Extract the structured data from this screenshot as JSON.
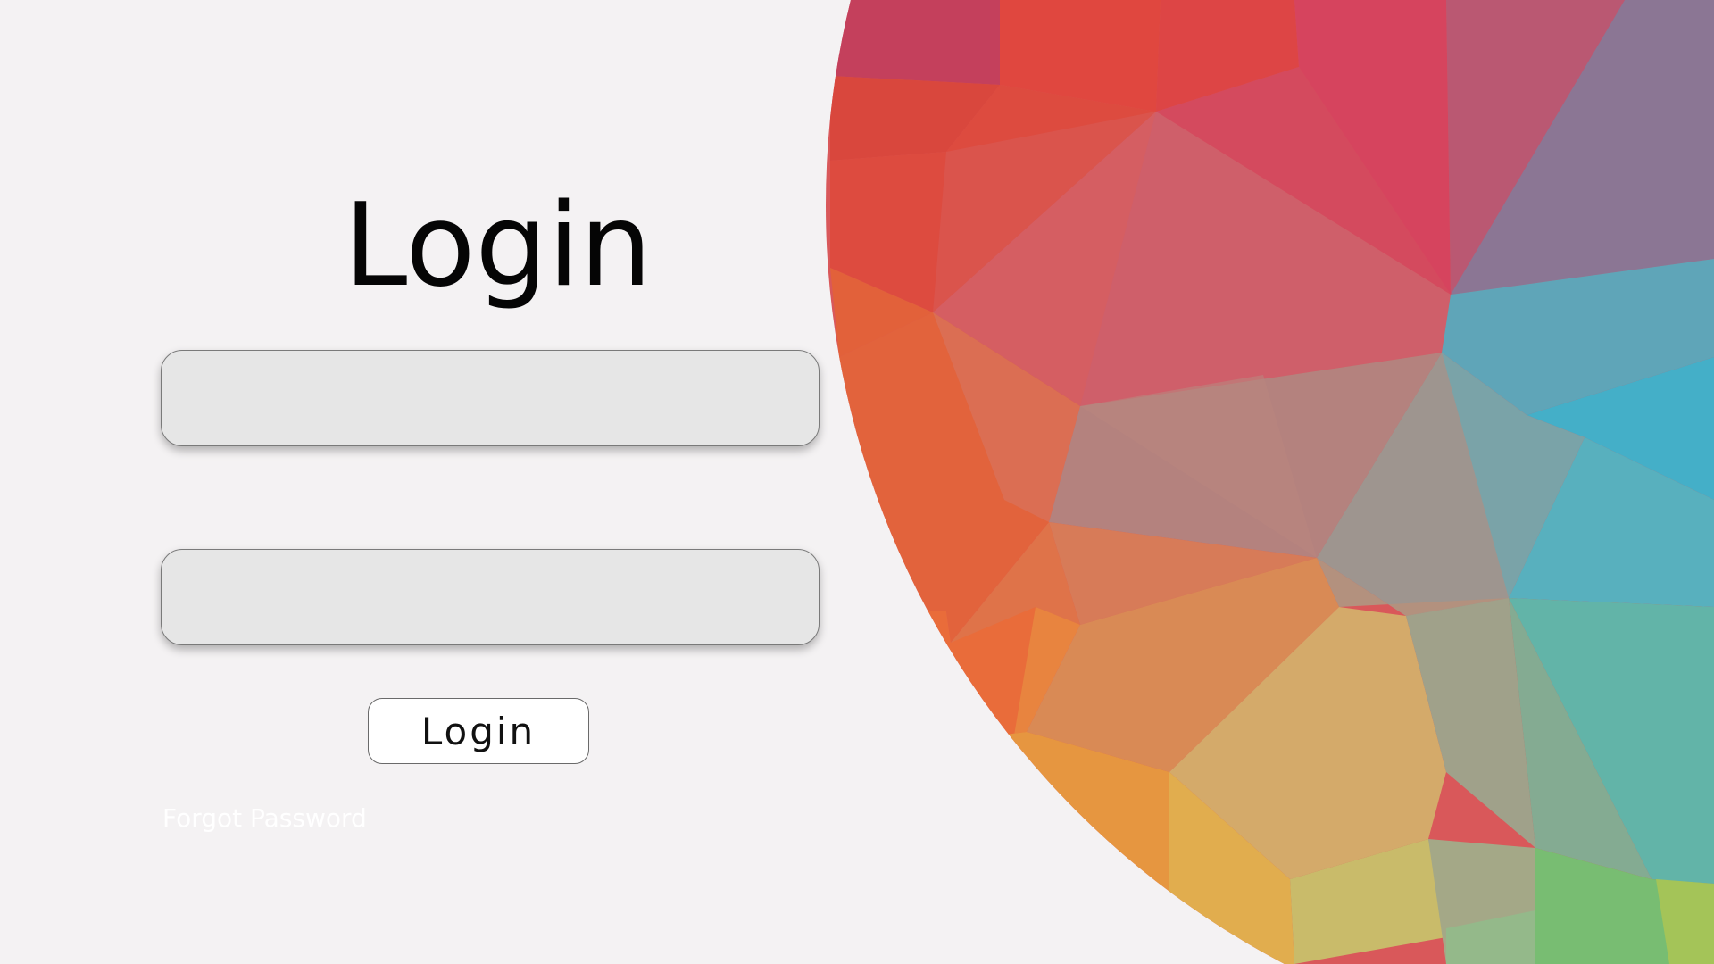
{
  "login_form": {
    "title": "Login",
    "username": {
      "value": "",
      "placeholder": ""
    },
    "password": {
      "value": "",
      "placeholder": ""
    },
    "login_button_label": "Login",
    "forgot_password_link": "Forgot Password"
  },
  "colors": {
    "page_background": "#f4f2f3",
    "input_background": "#e6e6e6",
    "input_border": "#7a7a7a",
    "button_background": "#ffffff",
    "forgot_link": "#ffffff",
    "art_red": "#d8384a",
    "art_orange": "#e8663a",
    "art_yellow": "#e0b15c",
    "art_blue": "#42aec8",
    "art_green": "#78bf6e"
  }
}
